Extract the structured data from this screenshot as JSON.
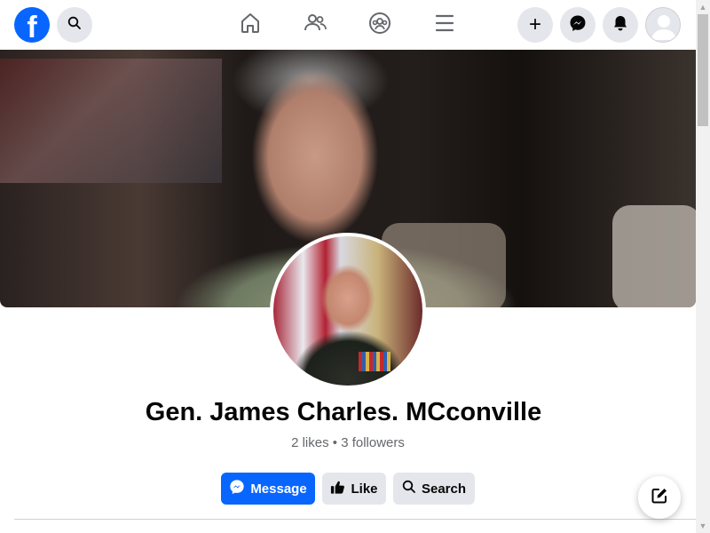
{
  "topbar": {
    "logo_letter": "f",
    "icons": {
      "search": "search-icon",
      "home": "home-icon",
      "friends": "friends-icon",
      "groups": "groups-icon",
      "menu": "menu-icon",
      "create": "plus-icon",
      "messenger": "messenger-icon",
      "notifications": "bell-icon",
      "account": "avatar-icon"
    },
    "create_glyph": "+"
  },
  "profile": {
    "name": "Gen. James Charles. MCconville",
    "stats": "2 likes • 3 followers"
  },
  "actions": {
    "message_label": "Message",
    "like_label": "Like",
    "search_label": "Search"
  },
  "colors": {
    "brand": "#0866ff",
    "button_gray": "#e4e6eb",
    "text_primary": "#050505",
    "text_secondary": "#65676b"
  }
}
